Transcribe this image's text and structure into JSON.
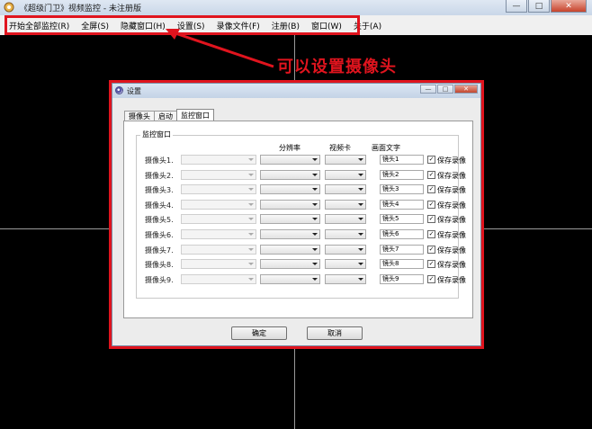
{
  "window": {
    "title": "《超级门卫》视频监控 - 未注册版",
    "buttons": {
      "minimize": "—",
      "maximize": "□",
      "close": "✕"
    }
  },
  "menu": {
    "items": [
      {
        "label": "开始全部监控(R)"
      },
      {
        "label": "全屏(S)"
      },
      {
        "label": "隐藏窗口(H)"
      },
      {
        "label": "设置(S)"
      },
      {
        "label": "录像文件(F)"
      },
      {
        "label": "注册(B)"
      },
      {
        "label": "窗口(W)"
      },
      {
        "label": "关于(A)"
      }
    ]
  },
  "annotation": {
    "text": "可以设置摄像头",
    "color": "#e0141e"
  },
  "dialog": {
    "title": "设置",
    "tabs": [
      {
        "label": "摄像头"
      },
      {
        "label": "启动"
      },
      {
        "label": "监控窗口",
        "active": true
      }
    ],
    "group_label": "监控窗口",
    "columns": {
      "resolution": "分辨率",
      "video_card": "视频卡",
      "caption": "画面文字"
    },
    "rows": [
      {
        "label": "摄像头1.",
        "caption": "镜头1",
        "save_label": "保存录像",
        "save_checked": "✓"
      },
      {
        "label": "摄像头2.",
        "caption": "镜头2",
        "save_label": "保存录像",
        "save_checked": "✓"
      },
      {
        "label": "摄像头3.",
        "caption": "镜头3",
        "save_label": "保存录像",
        "save_checked": "✓"
      },
      {
        "label": "摄像头4.",
        "caption": "镜头4",
        "save_label": "保存录像",
        "save_checked": "✓"
      },
      {
        "label": "摄像头5.",
        "caption": "镜头5",
        "save_label": "保存录像",
        "save_checked": "✓"
      },
      {
        "label": "摄像头6.",
        "caption": "镜头6",
        "save_label": "保存录像",
        "save_checked": "✓"
      },
      {
        "label": "摄像头7.",
        "caption": "镜头7",
        "save_label": "保存录像",
        "save_checked": "✓"
      },
      {
        "label": "摄像头8.",
        "caption": "镜头8",
        "save_label": "保存录像",
        "save_checked": "✓"
      },
      {
        "label": "摄像头9.",
        "caption": "镜头9",
        "save_label": "保存录像",
        "save_checked": "✓"
      }
    ],
    "ok_label": "确定",
    "cancel_label": "取消"
  },
  "colors": {
    "highlight": "#e0141e",
    "background": "#000000"
  }
}
